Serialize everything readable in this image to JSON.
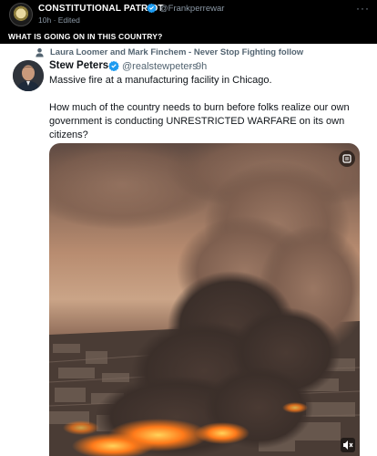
{
  "outer_post": {
    "author_name": "CONSTITUTIONAL PATRIOT",
    "handle": "@Frankperrewar",
    "time": "10h",
    "edited_label": "· Edited",
    "more_icon": "more-horizontal-icon",
    "caption": "WHAT IS GOING ON IN THIS COUNTRY?"
  },
  "embedded_tweet": {
    "retweet_label": "Laura Loomer and Mark Finchem - Never Stop Fighting follow",
    "author_name": "Stew Peters",
    "handle": "@realstewpeters",
    "separator": "·",
    "time": "9h",
    "text_line_1": "Massive fire at a manufacturing facility in Chicago.",
    "text_line_2": "How much of the country needs to burn before folks realize our own government is conducting UNRESTRICTED WARFARE on its own citizens?",
    "media_icons": [
      "gif-badge-icon",
      "volume-muted-icon"
    ]
  },
  "colors": {
    "verified": "#1d9bf0",
    "smoke": "#8a6a58",
    "fire": "#ff7a1a"
  }
}
